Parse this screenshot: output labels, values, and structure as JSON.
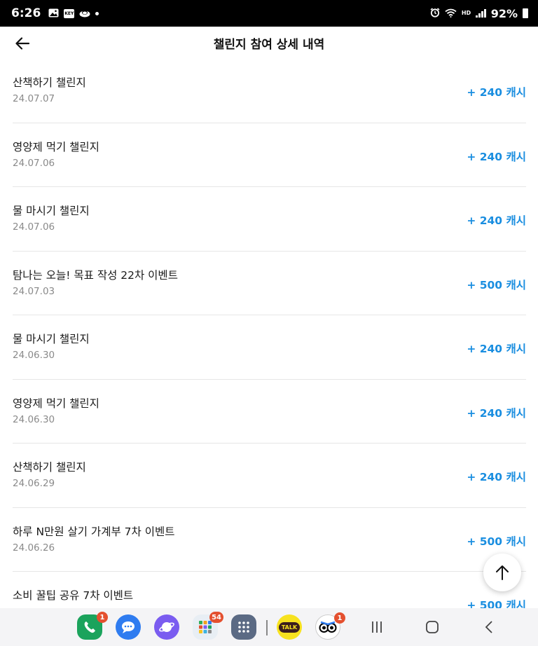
{
  "status_bar": {
    "time": "6:26",
    "battery": "92%",
    "icons": [
      "gallery-icon",
      "key-icon",
      "cloud-icon",
      "dot-icon",
      "alarm-icon",
      "wifi-icon",
      "hd-voice-icon",
      "signal-icon",
      "battery-icon"
    ],
    "hd_label": "HD",
    "key_label": "KEY"
  },
  "header": {
    "title": "챌린지 참여 상세 내역",
    "back_icon": "arrow-left-icon"
  },
  "items": [
    {
      "title": "산책하기 챌린지",
      "date": "24.07.07",
      "reward": "+ 240 캐시"
    },
    {
      "title": "영양제 먹기 챌린지",
      "date": "24.07.06",
      "reward": "+ 240 캐시"
    },
    {
      "title": "물 마시기 챌린지",
      "date": "24.07.06",
      "reward": "+ 240 캐시"
    },
    {
      "title": "탐나는 오늘! 목표 작성 22차 이벤트",
      "date": "24.07.03",
      "reward": "+ 500 캐시"
    },
    {
      "title": "물 마시기 챌린지",
      "date": "24.06.30",
      "reward": "+ 240 캐시"
    },
    {
      "title": "영양제 먹기 챌린지",
      "date": "24.06.30",
      "reward": "+ 240 캐시"
    },
    {
      "title": "산책하기 챌린지",
      "date": "24.06.29",
      "reward": "+ 240 캐시"
    },
    {
      "title": "하루 N만원 살기 가계부 7차 이벤트",
      "date": "24.06.26",
      "reward": "+ 500 캐시"
    },
    {
      "title": "소비 꿀팁 공유 7차 이벤트",
      "date": "",
      "reward": "+ 500 캐시"
    }
  ],
  "scroll_top": {
    "icon": "arrow-up-icon"
  },
  "dock": {
    "apps": [
      {
        "name": "phone-app",
        "badge": "1",
        "color": "#1ba35c"
      },
      {
        "name": "messages-app",
        "badge": "",
        "color": "#2f7cf0"
      },
      {
        "name": "internet-app",
        "badge": "",
        "color": "#7a5cf0"
      },
      {
        "name": "apps-folder",
        "badge": "54",
        "color": "#e8eef4"
      },
      {
        "name": "app-drawer",
        "badge": "",
        "color": "#5b6a84"
      },
      {
        "name": "kakaotalk-app",
        "badge": "",
        "color": "#f7e21f",
        "label": "TALK"
      },
      {
        "name": "tripadvisor-app",
        "badge": "1",
        "color": "#ffffff"
      }
    ],
    "system_buttons": [
      "recents-button",
      "home-button",
      "back-nav-button"
    ]
  },
  "colors": {
    "accent": "#1a8ee0",
    "badge": "#e4502f"
  }
}
